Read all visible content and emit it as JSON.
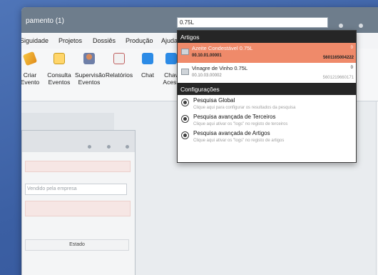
{
  "window": {
    "title": "pamento (1)"
  },
  "search": {
    "value": "0.75L"
  },
  "menu": {
    "items": [
      "Siguidade",
      "Projetos",
      "Dossiês",
      "Produção",
      "Ajuda"
    ]
  },
  "toolbar": {
    "items": [
      {
        "label": "Criar\nEvento",
        "icon": "pencil-icon"
      },
      {
        "label": "Consulta\nEventos",
        "icon": "document-icon"
      },
      {
        "label": "Supervisão\nEventos",
        "icon": "person-icon"
      },
      {
        "label": "Relatórios",
        "icon": "calculator-icon"
      },
      {
        "label": "Chat",
        "icon": "chat-icon"
      },
      {
        "label": "Chav\nAcess",
        "icon": "key-icon"
      }
    ]
  },
  "dropdown": {
    "artigos_header": "Artigos",
    "results": [
      {
        "name": "Azeite Condestável 0.75L",
        "code": "00.10.01.00001",
        "qty": "0",
        "ean": "5601165004222",
        "selected": true
      },
      {
        "name": "Vinagre de Vinho 0.75L",
        "code": "00.10.03.00002",
        "qty": "0",
        "ean": "5601219660171",
        "selected": false
      }
    ],
    "config_header": "Configurações",
    "configs": [
      {
        "title": "Pesquisa Global",
        "subtitle": "Clique aqui para configurar os resultados da pesquisa"
      },
      {
        "title": "Pesquisa avançada de Terceiros",
        "subtitle": "Clique aqui ativar os \"logs\" no registo de terceiros"
      },
      {
        "title": "Pesquisa avançada de Artigos",
        "subtitle": "Clique aqui ativar os \"logs\" no registo de artigos"
      }
    ]
  },
  "subwindow": {
    "select_value": "Vendido pela empresa",
    "table_header": "Estado"
  },
  "colors": {
    "titlebar": "#6e7d8c",
    "selected_result": "#ef8a6a",
    "section_header": "#262626",
    "background": "#3b5fa3"
  }
}
